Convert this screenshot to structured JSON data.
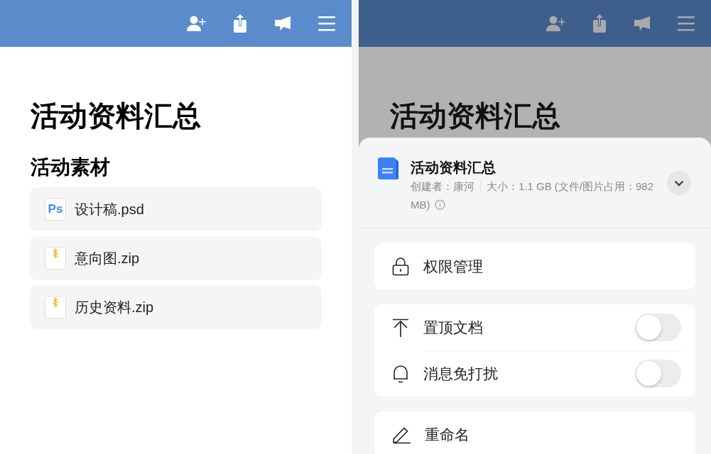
{
  "left_screen": {
    "title": "活动资料汇总",
    "section_title": "活动素材",
    "files": [
      {
        "name": "设计稿.psd",
        "kind": "psd",
        "badge": "Ps"
      },
      {
        "name": "意向图.zip",
        "kind": "zip"
      },
      {
        "name": "历史资料.zip",
        "kind": "zip"
      }
    ]
  },
  "right_screen": {
    "background_title": "活动资料汇总",
    "sheet": {
      "title": "活动资料汇总",
      "creator": "创建者：康河",
      "size": "大小：1.1 GB (文件/图片占用：982 MB)",
      "groups": [
        [
          {
            "label": "权限管理",
            "kind": "permissions"
          }
        ],
        [
          {
            "label": "置顶文档",
            "kind": "pin",
            "on": false
          },
          {
            "label": "消息免打扰",
            "kind": "mute",
            "on": false
          }
        ],
        [
          {
            "label": "重命名",
            "kind": "rename"
          }
        ]
      ]
    }
  }
}
